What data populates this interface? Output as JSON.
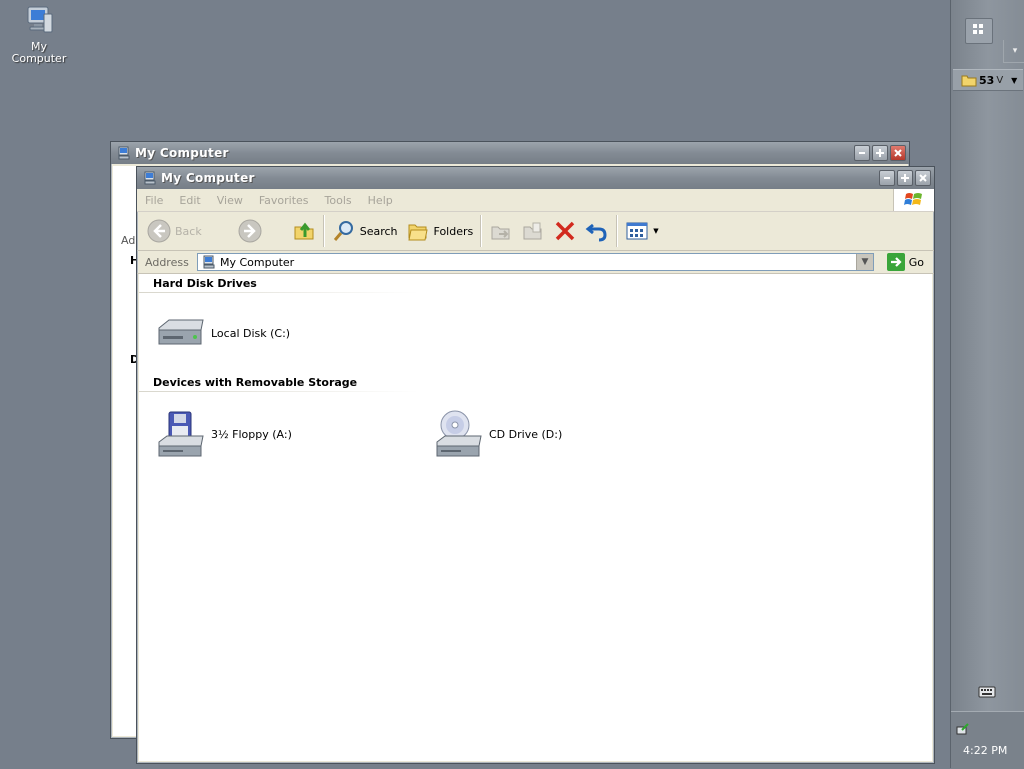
{
  "desktop": {
    "icon_label": "My Computer"
  },
  "side_panel": {
    "count": "53",
    "extra": "V",
    "clock": "4:22 PM"
  },
  "back_window": {
    "title": "My Computer",
    "fragment_row1": "Ad",
    "fragment_row2": "H",
    "fragment_row3": "D"
  },
  "window": {
    "title": "My Computer",
    "menu": [
      "File",
      "Edit",
      "View",
      "Favorites",
      "Tools",
      "Help"
    ],
    "toolbar": {
      "back": "Back",
      "search": "Search",
      "folders": "Folders"
    },
    "address": {
      "label": "Address",
      "value": "My Computer",
      "go": "Go"
    },
    "groups": [
      {
        "header": "Hard Disk Drives",
        "items": [
          {
            "label": "Local Disk (C:)",
            "icon": "hard-disk-icon"
          }
        ]
      },
      {
        "header": "Devices with Removable Storage",
        "items": [
          {
            "label": "3½ Floppy (A:)",
            "icon": "floppy-drive-icon"
          },
          {
            "label": "CD Drive (D:)",
            "icon": "cd-drive-icon"
          }
        ]
      }
    ]
  }
}
